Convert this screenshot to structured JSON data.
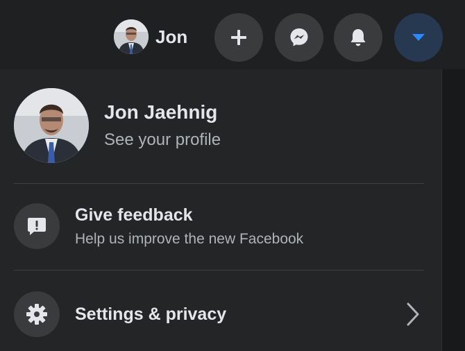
{
  "topbar": {
    "profile_chip": {
      "name": "Jon",
      "avatar": "profile-photo"
    },
    "buttons": [
      {
        "name": "create",
        "icon": "plus-icon"
      },
      {
        "name": "messenger",
        "icon": "messenger-icon"
      },
      {
        "name": "notifications",
        "icon": "bell-icon"
      },
      {
        "name": "account",
        "icon": "caret-down-icon",
        "active": true
      }
    ]
  },
  "menu": {
    "profile": {
      "name": "Jon Jaehnig",
      "subtitle": "See your profile"
    },
    "feedback": {
      "icon": "exclamation-icon",
      "title": "Give feedback",
      "subtitle": "Help us improve the new Facebook"
    },
    "settings": {
      "icon": "gear-icon",
      "title": "Settings & privacy",
      "chevron": "chevron-right-icon"
    }
  },
  "colors": {
    "background": "#18191a",
    "panel": "#242526",
    "button": "#3a3b3c",
    "accent": "#2d88ff",
    "text_primary": "#e4e6eb",
    "text_secondary": "#b0b3b8"
  }
}
